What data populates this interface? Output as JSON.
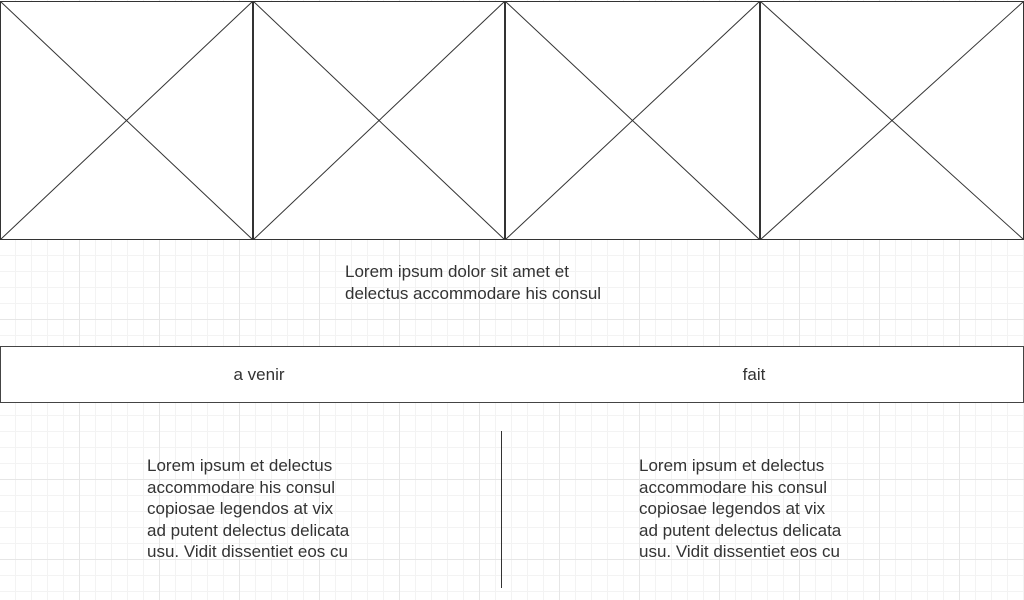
{
  "image_placeholders": [
    {
      "id": "image-placeholder-1"
    },
    {
      "id": "image-placeholder-2"
    },
    {
      "id": "image-placeholder-3"
    },
    {
      "id": "image-placeholder-4"
    }
  ],
  "caption": {
    "text": "Lorem ipsum dolor sit amet et\ndelectus accommodare his consul"
  },
  "tabs": {
    "left_label": "a venir",
    "right_label": "fait"
  },
  "columns": {
    "left_text": "Lorem ipsum et delectus\naccommodare his consul\ncopiosae legendos at vix\nad putent delectus delicata\nusu. Vidit dissentiet eos cu",
    "right_text": "Lorem ipsum et delectus\naccommodare his consul\ncopiosae legendos at vix\nad putent delectus delicata\nusu. Vidit dissentiet eos cu"
  },
  "colors": {
    "line": "#333333",
    "grid": "#e6e6e6",
    "text": "#333333"
  }
}
